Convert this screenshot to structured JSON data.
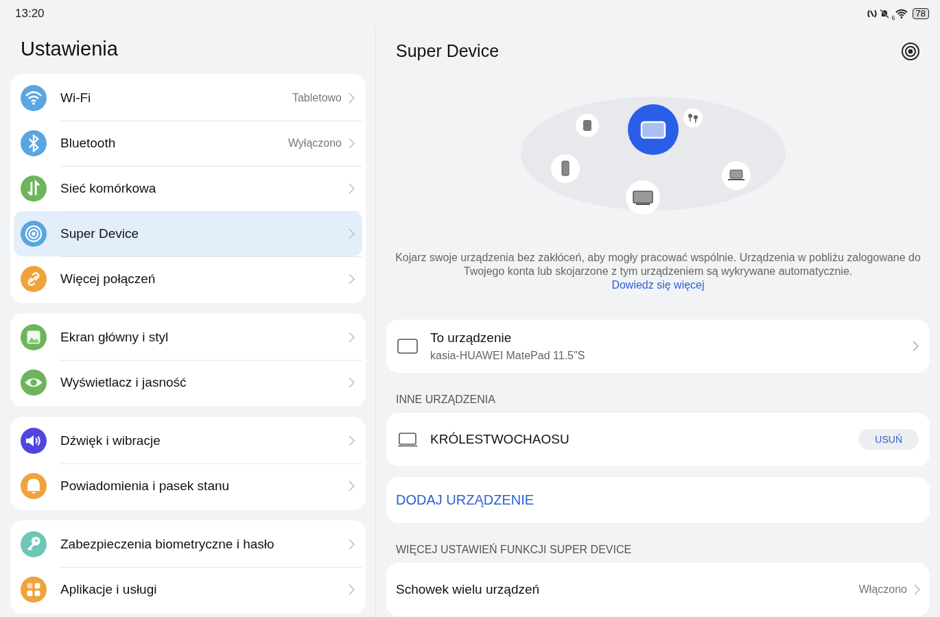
{
  "status_bar": {
    "time": "13:20",
    "wifi_label": "6",
    "battery": "78"
  },
  "settings": {
    "title": "Ustawienia",
    "groups": [
      [
        {
          "label": "Wi-Fi",
          "value": "Tabletowo",
          "color": "#5aa6e0",
          "selected": false
        },
        {
          "label": "Bluetooth",
          "value": "Wyłączono",
          "color": "#5aa6e0",
          "selected": false
        },
        {
          "label": "Sieć komórkowa",
          "color": "#6db55a",
          "selected": false
        },
        {
          "label": "Super Device",
          "color": "#5aa6e0",
          "selected": true
        },
        {
          "label": "Więcej połączeń",
          "color": "#f0a23c",
          "selected": false
        }
      ],
      [
        {
          "label": "Ekran główny i styl",
          "color": "#6db55a",
          "selected": false
        },
        {
          "label": "Wyświetlacz i jasność",
          "color": "#6db55a",
          "selected": false
        }
      ],
      [
        {
          "label": "Dźwięk i wibracje",
          "color": "#4f45e0",
          "selected": false
        },
        {
          "label": "Powiadomienia i pasek stanu",
          "color": "#f0a23c",
          "selected": false
        }
      ],
      [
        {
          "label": "Zabezpieczenia biometryczne i hasło",
          "color": "#6cc7b8",
          "selected": false
        },
        {
          "label": "Aplikacje i usługi",
          "color": "#f0a23c",
          "selected": false
        }
      ]
    ]
  },
  "super_device": {
    "title": "Super Device",
    "description": "Kojarz swoje urządzenia bez zakłóceń, aby mogły pracować wspólnie. Urządzenia w pobliżu zalogowane do Twojego konta lub skojarzone z tym urządzeniem są wykrywane automatycznie.",
    "learn_more": "Dowiedz się więcej",
    "this_device": {
      "title": "To urządzenie",
      "subtitle": "kasia-HUAWEI MatePad 11.5\"S"
    },
    "other_header": "INNE URZĄDZENIA",
    "other_devices": [
      {
        "name": "KRÓLESTWOCHAOSU",
        "action": "USUŃ"
      }
    ],
    "add_device": "DODAJ URZĄDZENIE",
    "more_header": "WIĘCEJ USTAWIEŃ FUNKCJI SUPER DEVICE",
    "more_settings": [
      {
        "label": "Schowek wielu urządzeń",
        "value": "Włączono"
      }
    ]
  }
}
